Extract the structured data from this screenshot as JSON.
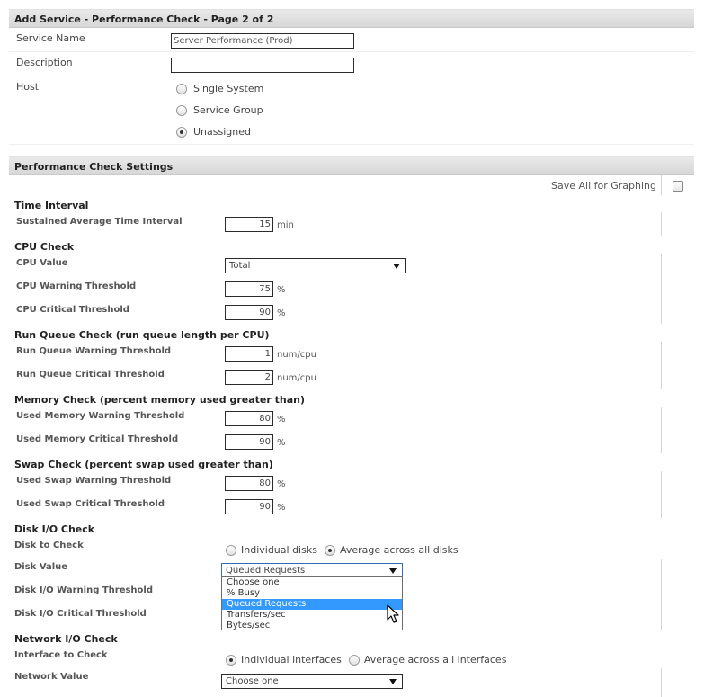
{
  "header": {
    "title": "Add Service - Performance Check - Page 2 of 2"
  },
  "form": {
    "service_name_label": "Service Name",
    "service_name_value": "Server Performance (Prod)",
    "description_label": "Description",
    "description_value": "",
    "host_label": "Host",
    "host_options": [
      "Single System",
      "Service Group",
      "Unassigned"
    ],
    "host_selected": "Unassigned"
  },
  "settings": {
    "title": "Performance Check Settings",
    "save_all_label": "Save All for Graphing",
    "save_all_checked": false
  },
  "time_interval": {
    "title": "Time Interval",
    "sustained_label": "Sustained Average Time Interval",
    "sustained_value": "15",
    "sustained_unit": "min"
  },
  "cpu": {
    "title": "CPU Check",
    "value_label": "CPU Value",
    "value_selected": "Total",
    "warning_label": "CPU Warning Threshold",
    "warning_value": "75",
    "critical_label": "CPU Critical Threshold",
    "critical_value": "90",
    "unit": "%"
  },
  "run_queue": {
    "title": "Run Queue Check (run queue length per CPU)",
    "warning_label": "Run Queue Warning Threshold",
    "warning_value": "1",
    "critical_label": "Run Queue Critical Threshold",
    "critical_value": "2",
    "unit": "num/cpu"
  },
  "memory": {
    "title": "Memory Check (percent memory used greater than)",
    "warning_label": "Used Memory Warning Threshold",
    "warning_value": "80",
    "critical_label": "Used Memory Critical Threshold",
    "critical_value": "90",
    "unit": "%"
  },
  "swap": {
    "title": "Swap Check (percent swap used greater than)",
    "warning_label": "Used Swap Warning Threshold",
    "warning_value": "80",
    "critical_label": "Used Swap Critical Threshold",
    "critical_value": "90",
    "unit": "%"
  },
  "disk": {
    "title": "Disk I/O Check",
    "disk_to_check_label": "Disk to Check",
    "disk_options": [
      "Individual disks",
      "Average across all disks"
    ],
    "disk_selected": "Average across all disks",
    "disk_value_label": "Disk Value",
    "disk_value_selected": "Queued Requests",
    "disk_value_options": [
      "Choose one",
      "% Busy",
      "Queued Requests",
      "Transfers/sec",
      "Bytes/sec"
    ],
    "warning_label": "Disk I/O Warning Threshold",
    "critical_label": "Disk I/O Critical Threshold"
  },
  "network": {
    "title": "Network I/O Check",
    "interface_label": "Interface to Check",
    "interface_options": [
      "Individual interfaces",
      "Average across all interfaces"
    ],
    "interface_selected": "Individual interfaces",
    "value_label": "Network Value",
    "value_selected": "Choose one"
  }
}
